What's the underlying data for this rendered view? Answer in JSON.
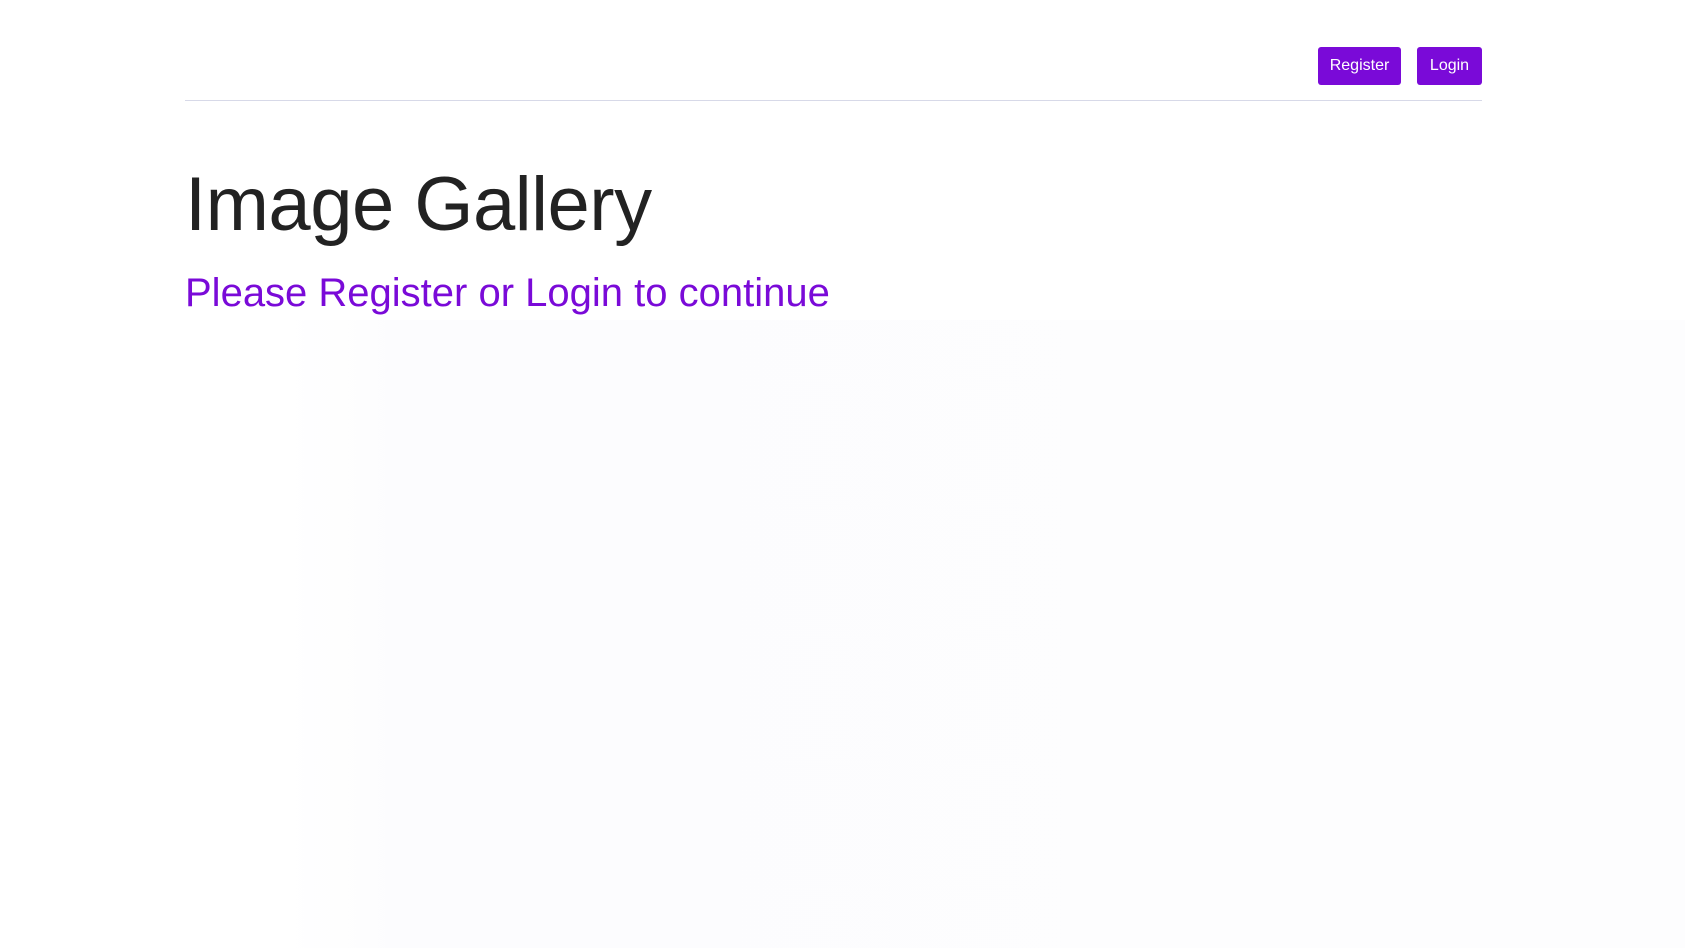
{
  "header": {
    "register_label": "Register",
    "login_label": "Login"
  },
  "hero": {
    "title": "Image Gallery",
    "subtitle": "Please Register or Login to continue"
  },
  "colors": {
    "accent": "#7a0ad8",
    "title_text": "#222222",
    "subtitle_text": "#7a0ad8",
    "divider": "#d7d9e8",
    "background": "#ffffff"
  }
}
